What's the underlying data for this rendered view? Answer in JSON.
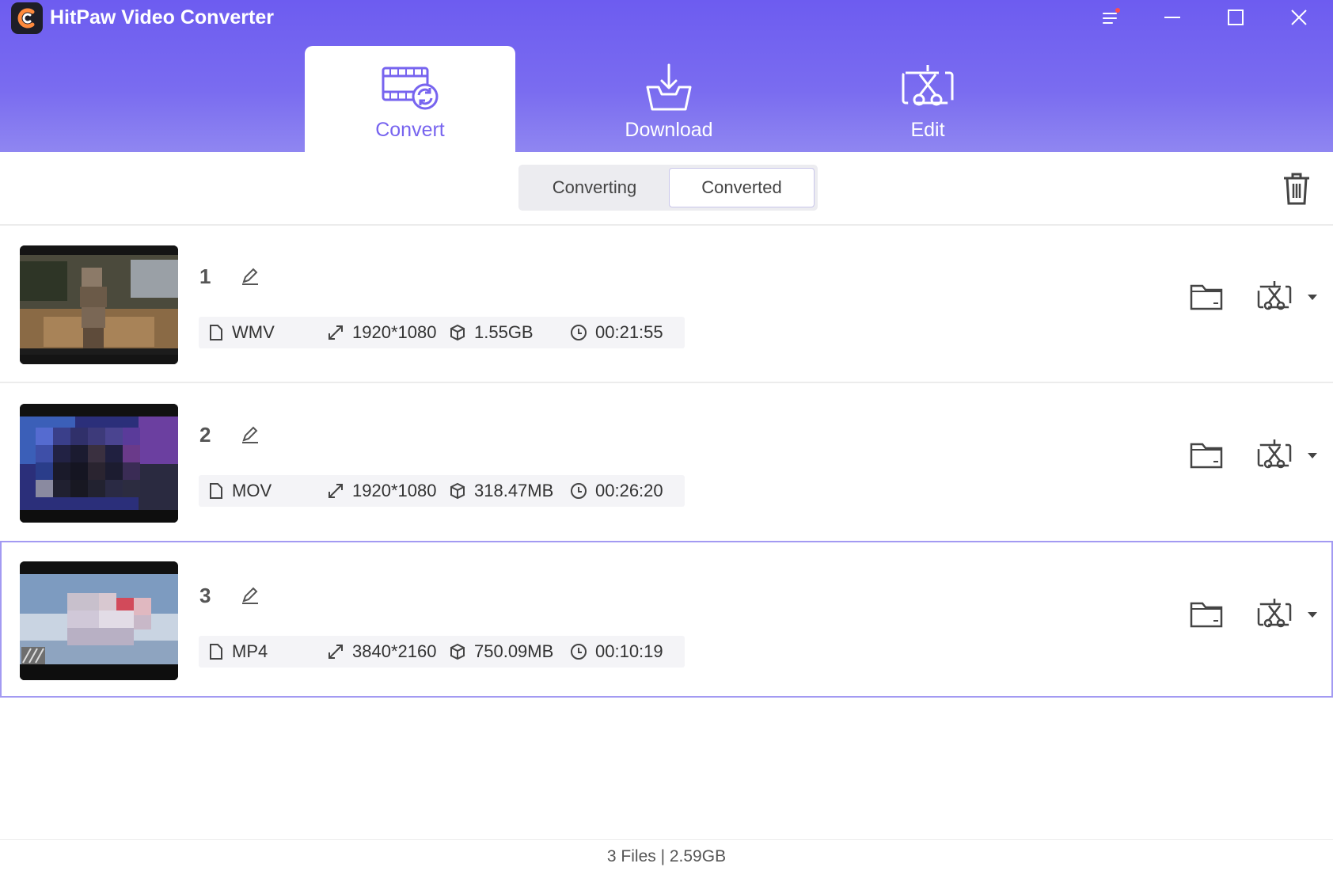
{
  "app": {
    "title": "HitPaw Video Converter"
  },
  "colors": {
    "accent": "#7764ef",
    "header_top": "#6d5cf0",
    "header_bottom": "#8f86f1",
    "notify_dot": "#ff4d4f"
  },
  "main_tabs": [
    {
      "label": "Convert",
      "icon": "convert-film-icon",
      "active": true
    },
    {
      "label": "Download",
      "icon": "download-tray-icon",
      "active": false
    },
    {
      "label": "Edit",
      "icon": "edit-scissors-icon",
      "active": false
    }
  ],
  "sub_tabs": [
    {
      "label": "Converting",
      "active": false
    },
    {
      "label": "Converted",
      "active": true
    }
  ],
  "files": [
    {
      "name": "1",
      "format": "WMV",
      "resolution": "1920*1080",
      "size": "1.55GB",
      "duration": "00:21:55",
      "selected": false
    },
    {
      "name": "2",
      "format": "MOV",
      "resolution": "1920*1080",
      "size": "318.47MB",
      "duration": "00:26:20",
      "selected": false
    },
    {
      "name": "3",
      "format": "MP4",
      "resolution": "3840*2160",
      "size": "750.09MB",
      "duration": "00:10:19",
      "selected": true
    }
  ],
  "footer": {
    "status": "3 Files | 2.59GB"
  }
}
